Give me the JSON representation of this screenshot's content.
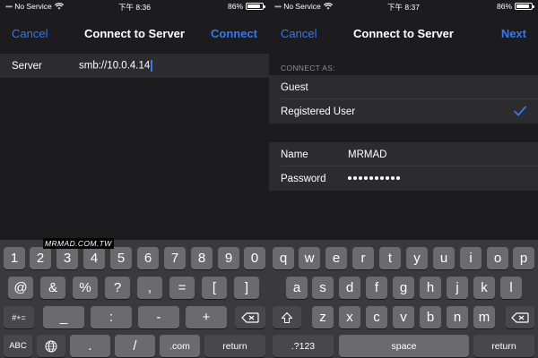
{
  "left": {
    "status": {
      "carrier": "No Service",
      "time": "下午 8:36",
      "battery": "86%"
    },
    "nav": {
      "cancel": "Cancel",
      "title": "Connect to Server",
      "action": "Connect"
    },
    "server_row": {
      "label": "Server",
      "value": "smb://10.0.4.14"
    },
    "keyboard": {
      "row1": [
        "1",
        "2",
        "3",
        "4",
        "5",
        "6",
        "7",
        "8",
        "9",
        "0"
      ],
      "row2": [
        "@",
        "&",
        "%",
        "?",
        ",",
        "=",
        "[",
        "]"
      ],
      "row3": [
        "#+=",
        "_",
        ":",
        "-",
        "+"
      ],
      "row4": [
        "ABC",
        ".",
        "/",
        ".com",
        "return"
      ]
    }
  },
  "right": {
    "status": {
      "carrier": "No Service",
      "time": "下午 8:37",
      "battery": "86%"
    },
    "nav": {
      "cancel": "Cancel",
      "title": "Connect to Server",
      "action": "Next"
    },
    "connect_as": {
      "header": "CONNECT AS:",
      "options": [
        {
          "label": "Guest",
          "selected": false
        },
        {
          "label": "Registered User",
          "selected": true
        }
      ]
    },
    "credentials": {
      "name_label": "Name",
      "name_value": "MRMAD",
      "password_label": "Password"
    },
    "keyboard": {
      "row1": [
        "q",
        "w",
        "e",
        "r",
        "t",
        "y",
        "u",
        "i",
        "o",
        "p"
      ],
      "row2": [
        "a",
        "s",
        "d",
        "f",
        "g",
        "h",
        "j",
        "k",
        "l"
      ],
      "row3": [
        "z",
        "x",
        "c",
        "v",
        "b",
        "n",
        "m"
      ],
      "row4": [
        ".?123",
        "space",
        "return"
      ]
    }
  },
  "watermark": "MRMAD.COM.TW",
  "colors": {
    "accent": "#3478f6",
    "background": "#1c1c1e",
    "cell": "#2c2c2e",
    "key": "#6b6b6e",
    "fn_key": "#48484a"
  }
}
